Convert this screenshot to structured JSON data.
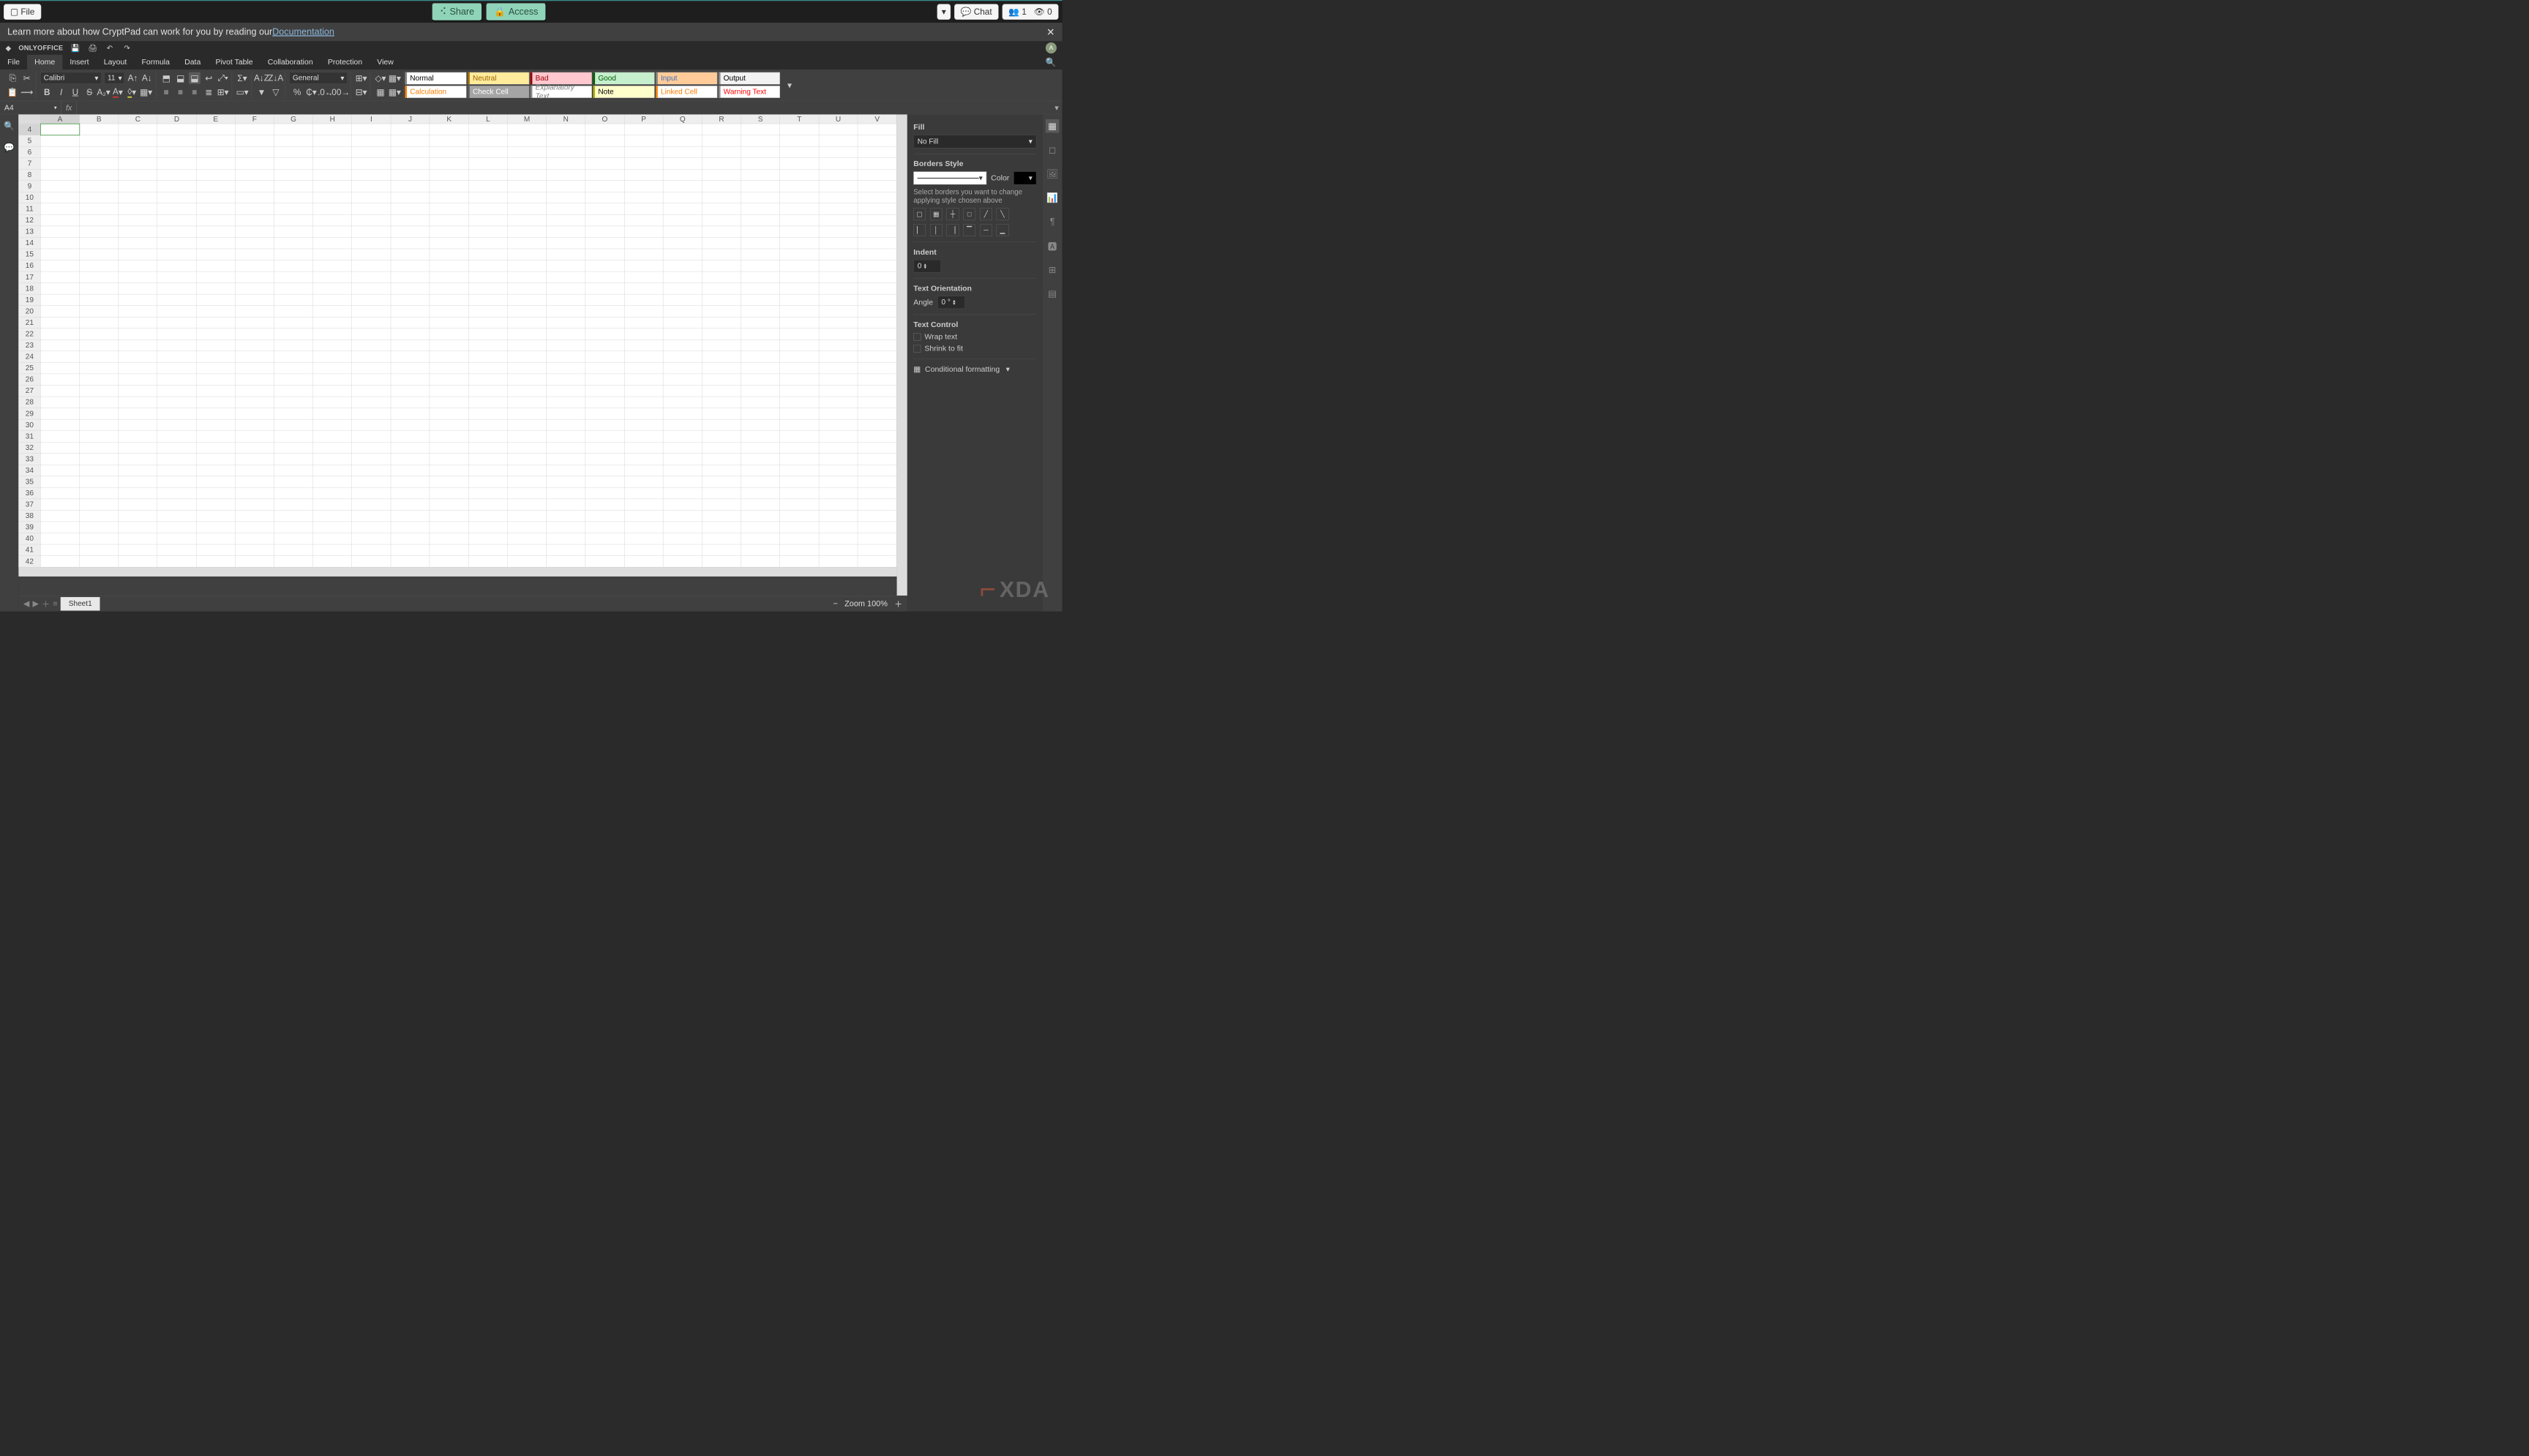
{
  "topbar": {
    "file": "File",
    "share": "Share",
    "access": "Access",
    "chat": "Chat",
    "users": "1",
    "views": "0"
  },
  "docbar": {
    "text": "Learn more about how CryptPad can work for you by reading our ",
    "link": "Documentation"
  },
  "brand": "ONLYOFFICE",
  "menu": [
    "File",
    "Home",
    "Insert",
    "Layout",
    "Formula",
    "Data",
    "Pivot Table",
    "Collaboration",
    "Protection",
    "View"
  ],
  "menu_active": 1,
  "font": {
    "name": "Calibri",
    "size": "11"
  },
  "numfmt": "General",
  "styles": [
    {
      "label": "Normal",
      "bg": "#ffffff",
      "color": "#000000",
      "border": "#888"
    },
    {
      "label": "Neutral",
      "bg": "#ffeb9c",
      "color": "#9c6500",
      "border": "#9c6500"
    },
    {
      "label": "Bad",
      "bg": "#ffc7ce",
      "color": "#9c0006",
      "border": "#9c0006"
    },
    {
      "label": "Good",
      "bg": "#c6efce",
      "color": "#006100",
      "border": "#006100"
    },
    {
      "label": "Input",
      "bg": "#ffcc99",
      "color": "#3f6fbf",
      "border": "#7f7f7f"
    },
    {
      "label": "Output",
      "bg": "#f2f2f2",
      "color": "#000000",
      "border": "#888"
    },
    {
      "label": "Calculation",
      "bg": "#ffffff",
      "color": "#fa7d00",
      "border": "#fa7d00"
    },
    {
      "label": "Check Cell",
      "bg": "#a5a5a5",
      "color": "#ffffff",
      "border": "#555"
    },
    {
      "label": "Explanatory Text",
      "bg": "#ffffff",
      "color": "#7f7f7f",
      "fs": "italic",
      "border": "#888"
    },
    {
      "label": "Note",
      "bg": "#ffffcc",
      "color": "#000000",
      "border": "#b2b200"
    },
    {
      "label": "Linked Cell",
      "bg": "#ffffff",
      "color": "#fa7d00",
      "border": "#fa7d00"
    },
    {
      "label": "Warning Text",
      "bg": "#ffffff",
      "color": "#ff0000",
      "border": "#888"
    }
  ],
  "namebox": "A4",
  "columns": [
    "A",
    "B",
    "C",
    "D",
    "E",
    "F",
    "G",
    "H",
    "I",
    "J",
    "K",
    "L",
    "M",
    "N",
    "O",
    "P",
    "Q",
    "R",
    "S",
    "T",
    "U",
    "V"
  ],
  "rows_start": 4,
  "rows_end": 42,
  "selected_cell": {
    "col": "A",
    "row": 4
  },
  "sheet": "Sheet1",
  "zoom": "Zoom 100%",
  "rpanel": {
    "fill_label": "Fill",
    "fill_value": "No Fill",
    "borders_label": "Borders Style",
    "color_label": "Color",
    "borders_hint": "Select borders you want to change applying style chosen above",
    "indent_label": "Indent",
    "indent_value": "0",
    "orient_label": "Text Orientation",
    "angle_label": "Angle",
    "angle_value": "0 °",
    "textctl_label": "Text Control",
    "wrap": "Wrap text",
    "shrink": "Shrink to fit",
    "condfmt": "Conditional formatting"
  },
  "avatar": "A",
  "watermark": "XDA"
}
